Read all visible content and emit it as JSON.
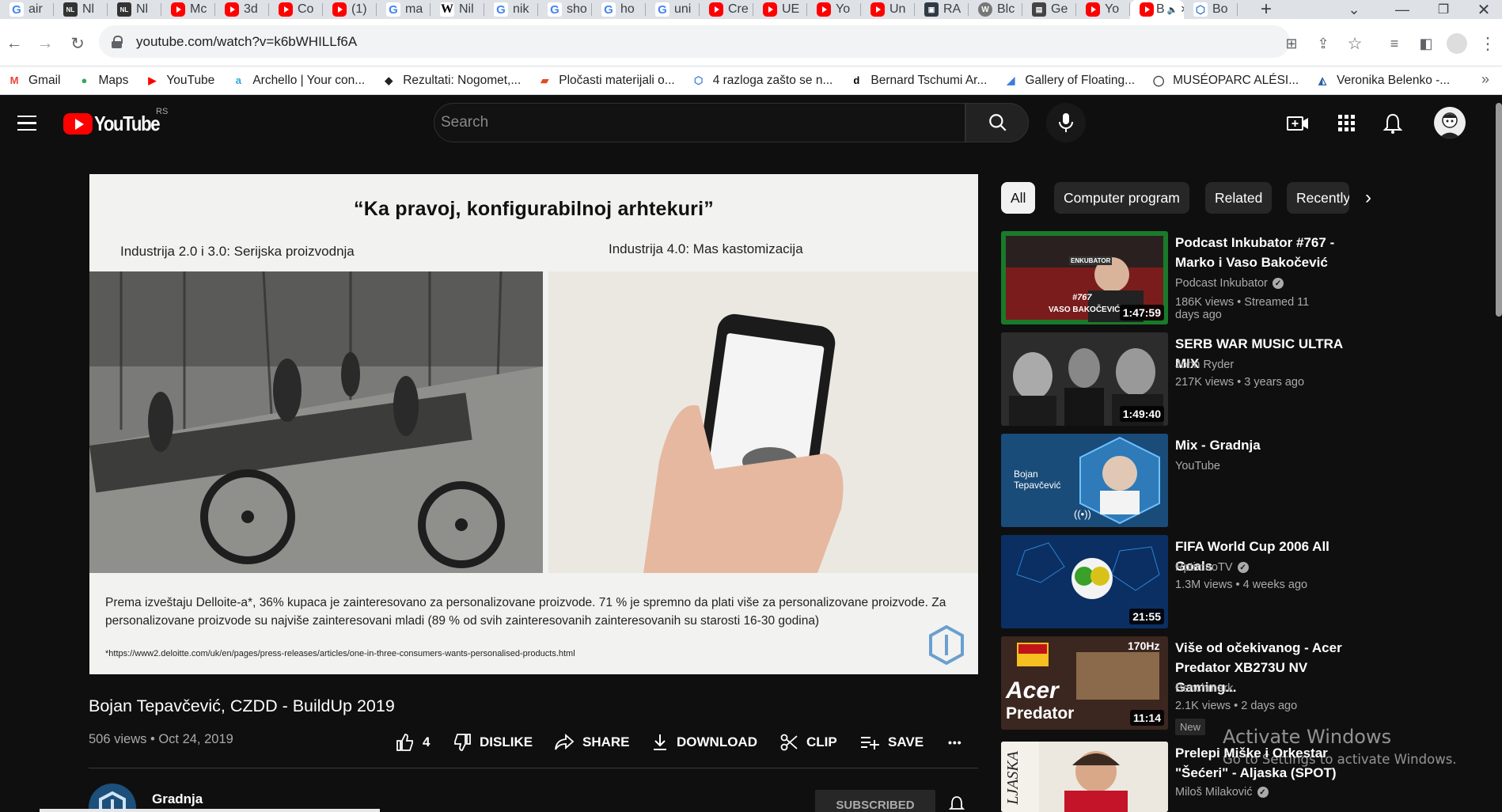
{
  "browser": {
    "tabs": [
      {
        "icon": "google-icon",
        "label": "air"
      },
      {
        "icon": "nl-icon",
        "label": "Nl"
      },
      {
        "icon": "nl-icon",
        "label": "Nl"
      },
      {
        "icon": "youtube-icon",
        "label": "Mc"
      },
      {
        "icon": "youtube-icon",
        "label": "3d"
      },
      {
        "icon": "youtube-icon",
        "label": "Co"
      },
      {
        "icon": "youtube-icon",
        "label": "(1)"
      },
      {
        "icon": "google-icon",
        "label": "ma"
      },
      {
        "icon": "wikipedia-icon",
        "label": "Nil"
      },
      {
        "icon": "google-icon",
        "label": "nik"
      },
      {
        "icon": "google-icon",
        "label": "sho"
      },
      {
        "icon": "google-icon",
        "label": "ho"
      },
      {
        "icon": "google-icon",
        "label": "uni"
      },
      {
        "icon": "youtube-icon",
        "label": "Cre"
      },
      {
        "icon": "youtube-icon",
        "label": "UE"
      },
      {
        "icon": "youtube-icon",
        "label": "Yo"
      },
      {
        "icon": "youtube-icon",
        "label": "Un"
      },
      {
        "icon": "ra-icon",
        "label": "RA"
      },
      {
        "icon": "wordpress-icon",
        "label": "Blc"
      },
      {
        "icon": "ge-icon",
        "label": "Ge"
      },
      {
        "icon": "youtube-icon",
        "label": "Yo"
      },
      {
        "icon": "youtube-icon",
        "label": "B"
      },
      {
        "icon": "bo-icon",
        "label": "Bo"
      }
    ],
    "url": "youtube.com/watch?v=k6bWHILLf6A",
    "bookmarks": [
      {
        "icon": "gmail-icon",
        "label": "Gmail"
      },
      {
        "icon": "maps-icon",
        "label": "Maps"
      },
      {
        "icon": "youtube-icon",
        "label": "YouTube"
      },
      {
        "icon": "archello-icon",
        "label": "Archello | Your con..."
      },
      {
        "icon": "rezultati-icon",
        "label": "Rezultati: Nogomet,..."
      },
      {
        "icon": "plocasti-icon",
        "label": "Pločasti materijali o..."
      },
      {
        "icon": "bo-icon",
        "label": "4 razloga zašto se n..."
      },
      {
        "icon": "tschumi-icon",
        "label": "Bernard Tschumi Ar..."
      },
      {
        "icon": "gallery-icon",
        "label": "Gallery of Floating..."
      },
      {
        "icon": "museo-icon",
        "label": "MUSÉOPARC ALÉSI..."
      },
      {
        "icon": "veronika-icon",
        "label": "Veronika Belenko -..."
      }
    ],
    "more_bookmarks": "»"
  },
  "youtube": {
    "logo_text": "YouTube",
    "country_code": "RS",
    "search_placeholder": "Search"
  },
  "slide": {
    "title": "“Ka pravoj, konfigurabilnoj arhtekuri”",
    "left_caption": "Industrija 2.0 i 3.0: Serijska proizvodnja",
    "right_caption": "Industrija 4.0: Mas kastomizacija",
    "body": "Prema izveštaju Delloite-a*, 36% kupaca je zainteresovano za personalizovane proizvode. 71 % je spremno da plati više za personalizovane proizvode. Za personalizovane proizvode su najviše zainteresovani mladi (89 % od svih zainteresovanih zainteresovanih su starosti 16-30 godina)",
    "footnote": "*https://www2.deloitte.com/uk/en/pages/press-releases/articles/one-in-three-consumers-wants-personalised-products.html"
  },
  "video": {
    "title": "Bojan Tepavčević, CZDD - BuildUp 2019",
    "meta": "506 views • Oct 24, 2019",
    "likes": "4",
    "dislike": "DISLIKE",
    "share": "SHARE",
    "download": "DOWNLOAD",
    "clip": "CLIP",
    "save": "SAVE",
    "more": "•••"
  },
  "channel": {
    "name": "Gradnja",
    "subscribe": "SUBSCRIBED"
  },
  "chips": [
    "All",
    "Computer program",
    "Related",
    "Recently uploaded"
  ],
  "related": [
    {
      "title": "Podcast Inkubator #767 - Marko i Vaso Bakočević",
      "channel": "Podcast Inkubator",
      "verified": true,
      "meta": "186K views • Streamed 11 days ago",
      "duration": "1:47:59"
    },
    {
      "title": "SERB WAR MUSIC ULTRA MIX",
      "channel": "John Ryder",
      "verified": false,
      "meta": "217K views • 3 years ago",
      "duration": "1:49:40"
    },
    {
      "title": "Mix - Gradnja",
      "channel": "YouTube",
      "verified": false,
      "meta": "",
      "duration": ""
    },
    {
      "title": "FIFA World Cup 2006 All Goals",
      "channel": "RptimaoTV",
      "verified": true,
      "meta": "1.3M views • 4 weeks ago",
      "duration": "21:55"
    },
    {
      "title": "Više od očekivanog - Acer Predator XB273U NV Gaming...",
      "channel": "Benchmark",
      "verified": false,
      "meta": "2.1K views • 2 days ago",
      "duration": "11:14",
      "badge": "New"
    },
    {
      "title": "Prelepi Miške i Orkestar \"Šećeri\" - Aljaska (SPOT)",
      "channel": "Miloš Milaković",
      "verified": true,
      "meta": "",
      "duration": ""
    }
  ],
  "thumb_text": {
    "podcast_number": "#767",
    "podcast_name": "VASO BAKOČEVIĆ",
    "podcast_sign": "ENKUBATOR",
    "mix_name": "Bojan Tepavčević",
    "acer_brand": "Acer",
    "acer_line": "Predator",
    "acer_hz": "170Hz",
    "aljaska": "LJASKA"
  },
  "watermark": {
    "line1": "Activate Windows",
    "line2": "Go to Settings to activate Windows."
  }
}
